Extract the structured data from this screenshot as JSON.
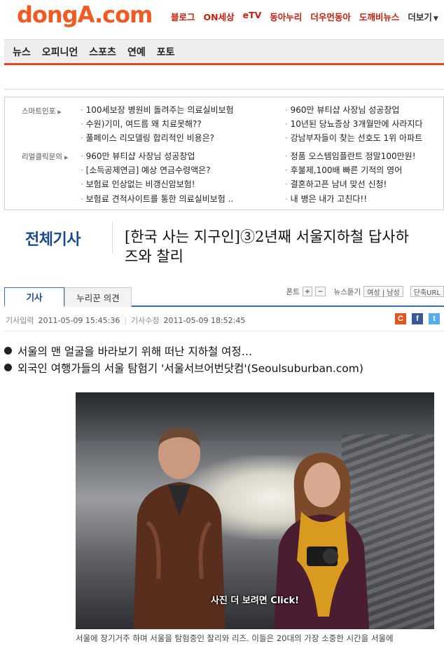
{
  "header": {
    "logo_text": "dongA.com",
    "nav": [
      "블로그",
      "ON세상",
      "eTV",
      "동아누리",
      "더우먼동아",
      "도깨비뉴스"
    ],
    "more_label": "더보기"
  },
  "sections": [
    "뉴스",
    "오피니언",
    "스포츠",
    "연예",
    "포토"
  ],
  "ads": {
    "group1_label": "스마트인포",
    "group2_label": "리얼클릭문의",
    "left_top": [
      "100세보장 병원비 돌려주는 의료실비보험",
      "수원)기미, 여드름 왜 치료못해??",
      "풀페이스 리모델링 합리적인 비용은?"
    ],
    "right_top": [
      "960만 뷰티샵 사장님 성공창업",
      "10년된 당뇨증상 3개월만에 사라지다",
      "강남부자들이 찾는 선호도 1위 아파트"
    ],
    "left_bottom": [
      "960만 뷰티샵 사장님 성공창업",
      "[소득공제연금] 예상 연금수령액은?",
      "보험료 인상없는 비갱신암보험!",
      "보험료 견적사이트를 통한 의료실비보험 .."
    ],
    "right_bottom": [
      "정품 오스템임플란트 정말100만원!",
      "후불제,100배 빠른 기적의 영어",
      "결혼하고픈 남녀 맞선 신청!",
      "내 병은 내가 고친다!!"
    ]
  },
  "article": {
    "category": "전체기사",
    "headline_line1": "[한국 사는 지구인]③2년째 서울지하철 답사하",
    "headline_line2": "즈와 찰리",
    "tab_article": "기사",
    "tab_comments": "누리꾼 의견",
    "font_label": "폰트",
    "font_plus": "+",
    "font_minus": "−",
    "listen_label": "뉴스듣기",
    "voice_option": "여성 | 남성",
    "short_url_label": "단축URL",
    "input_label": "기사입력",
    "input_date": "2011-05-09 15:45:36",
    "modified_label": "기사수정",
    "modified_date": "2011-05-09 18:52:45",
    "bullet1": "서울의 맨 얼굴을 바라보기 위해 떠난 지하철 여정…",
    "bullet2": "외국인 여행가들의 서울 탐험기 '서울서브어번닷컴'(Seoulsuburban.com)",
    "photo_overlay": "사진 더 보려면 Click!",
    "photo_caption": "서울에 장기거주 하며 서울을 탐험중인 찰리와 리즈. 이들은 20대의 가장 소중한 시간을 서울에"
  },
  "share": {
    "c": "C",
    "f": "f",
    "t": "t"
  }
}
